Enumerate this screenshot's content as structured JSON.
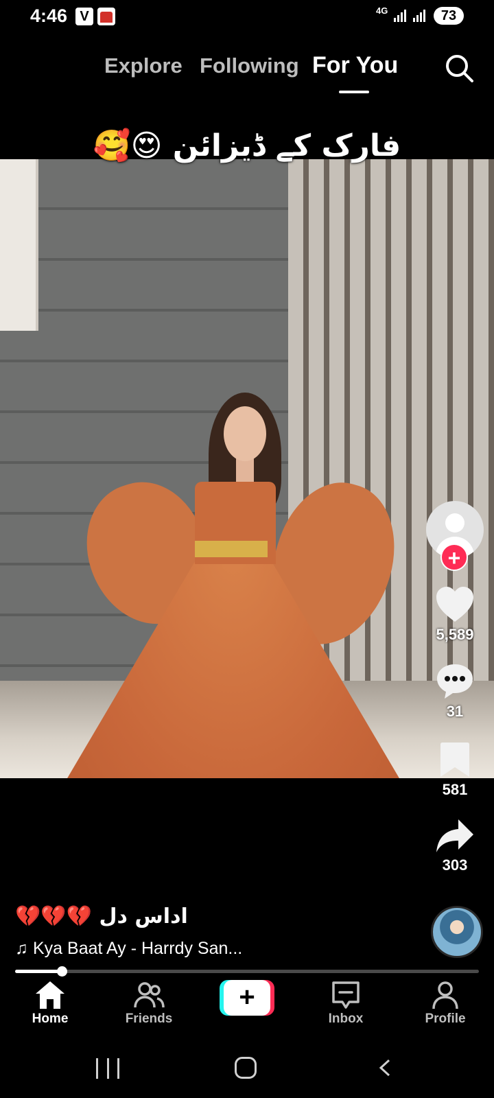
{
  "status_bar": {
    "time": "4:46",
    "app_badge_v": "V",
    "network": "4G",
    "battery": "73"
  },
  "top_tabs": {
    "explore": "Explore",
    "following": "Following",
    "for_you": "For You",
    "active": "For You"
  },
  "video": {
    "overlay_text": "فارک کے ڈیزائن 😍🥰"
  },
  "actions": {
    "likes": "5,589",
    "comments": "31",
    "saves": "581",
    "shares": "303"
  },
  "post": {
    "caption": "💔💔💔 اداس دل",
    "music": "Kya Baat Ay - Harrdy San...",
    "progress": 0.1
  },
  "bottom_nav": {
    "home": "Home",
    "friends": "Friends",
    "create": "+",
    "inbox": "Inbox",
    "profile": "Profile"
  },
  "colors": {
    "accent_red": "#fe2c55",
    "accent_cyan": "#25f4ee",
    "background": "#000000"
  }
}
